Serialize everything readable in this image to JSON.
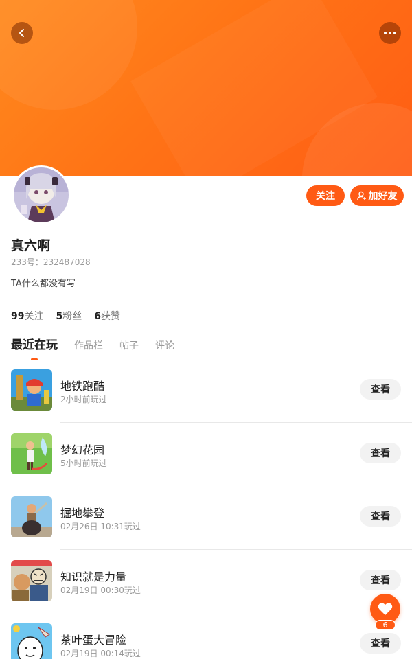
{
  "header": {
    "back_icon": "chevron-left-icon",
    "more_icon": "more-dots-icon",
    "accent_color": "#ff5a14"
  },
  "profile": {
    "name": "真六啊",
    "uid_label": "233号：232487028",
    "bio": "TA什么都没有写",
    "follow_label": "关注",
    "add_friend_label": "加好友"
  },
  "stats": [
    {
      "value": "99",
      "label": "关注"
    },
    {
      "value": "5",
      "label": "粉丝"
    },
    {
      "value": "6",
      "label": "获赞"
    }
  ],
  "tabs": [
    {
      "label": "最近在玩",
      "active": true
    },
    {
      "label": "作品栏",
      "active": false
    },
    {
      "label": "帖子",
      "active": false
    },
    {
      "label": "评论",
      "active": false
    }
  ],
  "games": [
    {
      "title": "地铁跑酷",
      "time": "2小时前玩过",
      "button": "查看"
    },
    {
      "title": "梦幻花园",
      "time": "5小时前玩过",
      "button": "查看"
    },
    {
      "title": "掘地攀登",
      "time": "02月26日 10:31玩过",
      "button": "查看"
    },
    {
      "title": "知识就是力量",
      "time": "02月19日 00:30玩过",
      "button": "查看"
    },
    {
      "title": "茶叶蛋大冒险",
      "time": "02月19日 00:14玩过",
      "button": "查看"
    }
  ],
  "like_fab": {
    "icon": "heart-icon",
    "count": "6"
  }
}
